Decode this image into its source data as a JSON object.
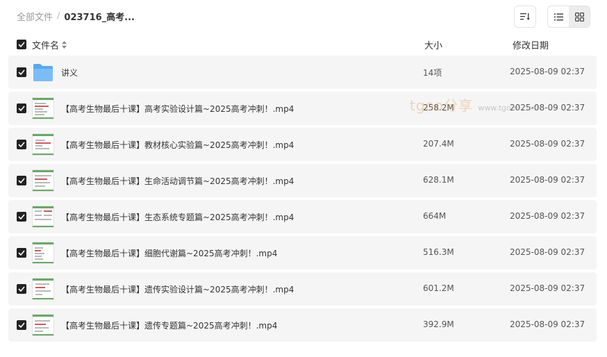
{
  "breadcrumb": {
    "root": "全部文件",
    "separator": "/",
    "current": "023716_高考..."
  },
  "toolbar": {
    "sort_icon": "sort-icon",
    "list_view_icon": "list-view-icon",
    "grid_view_icon": "grid-view-icon"
  },
  "columns": {
    "name": "文件名",
    "size": "大小",
    "date": "修改日期"
  },
  "watermark": {
    "brand": "tgoo分享",
    "url": "www.tgoos.com"
  },
  "files": [
    {
      "name": "讲义",
      "size": "14项",
      "date": "2025-08-09 02:37",
      "type": "folder"
    },
    {
      "name": "【高考生物最后十课】高考实验设计篇~2025高考冲刺！.mp4",
      "size": "258.2M",
      "date": "2025-08-09 02:37",
      "type": "video"
    },
    {
      "name": "【高考生物最后十课】教材核心实验篇~2025高考冲刺！.mp4",
      "size": "207.4M",
      "date": "2025-08-09 02:37",
      "type": "video"
    },
    {
      "name": "【高考生物最后十课】生命活动调节篇~2025高考冲刺！.mp4",
      "size": "628.1M",
      "date": "2025-08-09 02:37",
      "type": "video"
    },
    {
      "name": "【高考生物最后十课】生态系统专题篇~2025高考冲刺！.mp4",
      "size": "664M",
      "date": "2025-08-09 02:37",
      "type": "video"
    },
    {
      "name": "【高考生物最后十课】细胞代谢篇~2025高考冲刺！.mp4",
      "size": "516.3M",
      "date": "2025-08-09 02:37",
      "type": "video"
    },
    {
      "name": "【高考生物最后十课】遗传实验设计篇~2025高考冲刺！.mp4",
      "size": "601.2M",
      "date": "2025-08-09 02:37",
      "type": "video"
    },
    {
      "name": "【高考生物最后十课】遗传专题篇~2025高考冲刺！.mp4",
      "size": "392.9M",
      "date": "2025-08-09 02:37",
      "type": "video"
    }
  ],
  "colors": {
    "folder": "#5aa7ee",
    "row_bg": "#f5f5f6",
    "checkbox": "#222222"
  }
}
